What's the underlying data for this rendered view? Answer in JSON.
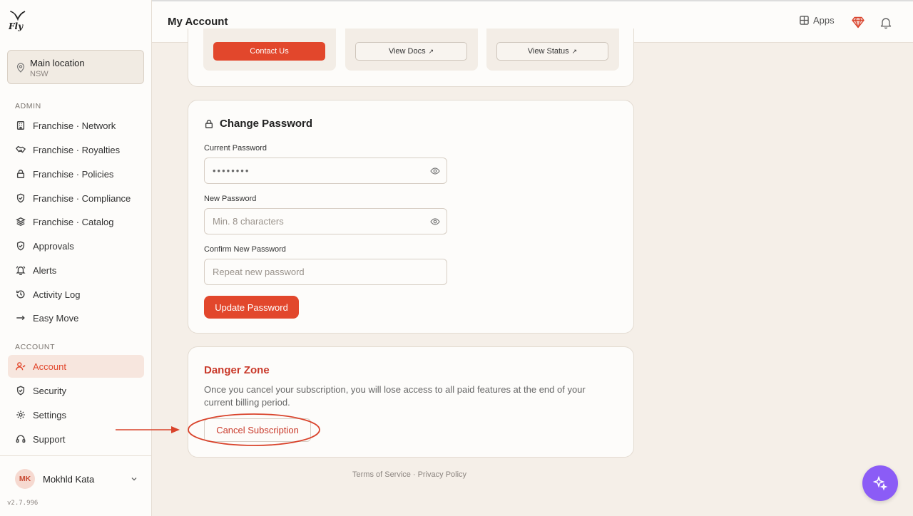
{
  "app": {
    "brand": "Fly",
    "version": "v2.7.996"
  },
  "location": {
    "name": "Main location",
    "region": "NSW"
  },
  "sidebar": {
    "admin_label": "ADMIN",
    "admin_items": [
      {
        "label": "Franchise · Network",
        "icon": "building-icon"
      },
      {
        "label": "Franchise · Royalties",
        "icon": "handshake-icon"
      },
      {
        "label": "Franchise · Policies",
        "icon": "lock-icon"
      },
      {
        "label": "Franchise · Compliance",
        "icon": "shield-check-icon"
      },
      {
        "label": "Franchise · Catalog",
        "icon": "layers-icon"
      },
      {
        "label": "Approvals",
        "icon": "shield-check-icon"
      },
      {
        "label": "Alerts",
        "icon": "bell-icon"
      },
      {
        "label": "Activity Log",
        "icon": "history-icon"
      },
      {
        "label": "Easy Move",
        "icon": "arrow-right-icon"
      }
    ],
    "account_label": "ACCOUNT",
    "account_items": [
      {
        "label": "Account",
        "icon": "user-icon",
        "active": true
      },
      {
        "label": "Security",
        "icon": "shield-check-icon"
      },
      {
        "label": "Settings",
        "icon": "gear-icon"
      },
      {
        "label": "Support",
        "icon": "headset-icon"
      }
    ]
  },
  "user": {
    "initials": "MK",
    "name": "Mokhld Kata"
  },
  "header": {
    "title": "My Account",
    "apps_label": "Apps"
  },
  "help_tiles": {
    "contact_label": "Contact Us",
    "docs_label": "View Docs",
    "status_label": "View Status",
    "external_glyph": "↗"
  },
  "change_password": {
    "title": "Change Password",
    "current_label": "Current Password",
    "current_value": "••••••••",
    "new_label": "New Password",
    "new_placeholder": "Min. 8 characters",
    "confirm_label": "Confirm New Password",
    "confirm_placeholder": "Repeat new password",
    "submit_label": "Update Password"
  },
  "danger_zone": {
    "title": "Danger Zone",
    "description": "Once you cancel your subscription, you will lose access to all paid features at the end of your current billing period.",
    "cancel_label": "Cancel Subscription"
  },
  "footer": {
    "terms": "Terms of Service",
    "separator": "·",
    "privacy": "Privacy Policy"
  },
  "colors": {
    "accent": "#e2472c",
    "danger": "#c9392a",
    "fab": "#8b5cf6",
    "background": "#f5efe8"
  }
}
